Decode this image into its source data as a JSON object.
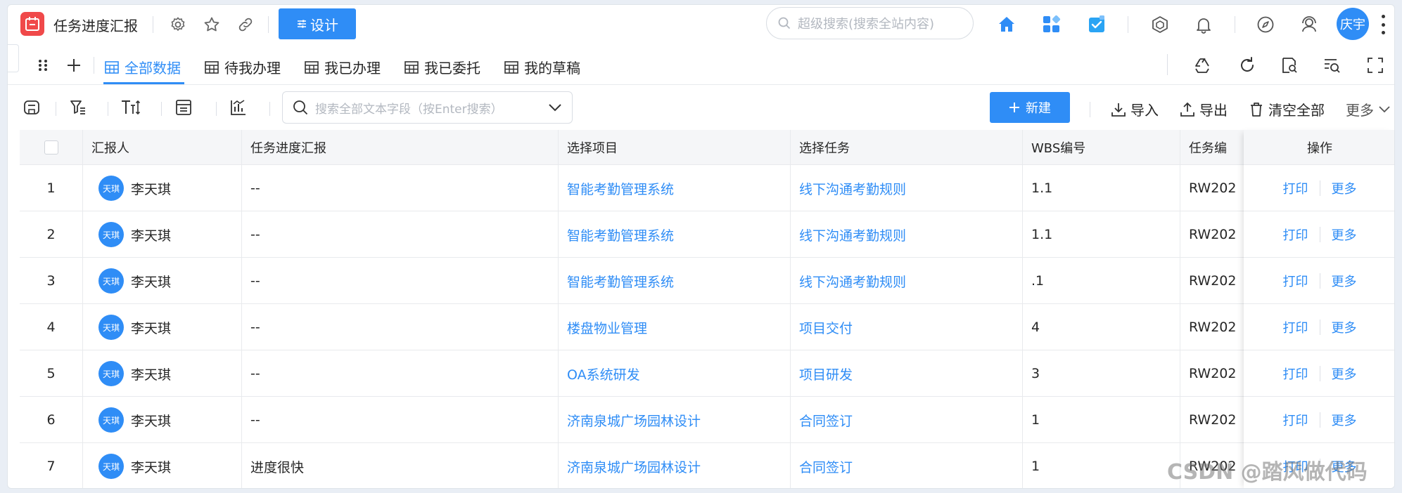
{
  "header": {
    "app_title": "任务进度汇报",
    "design_label": "设计",
    "search_placeholder": "超级搜索(搜索全站内容)",
    "user_name": "庆宇"
  },
  "tabs": [
    {
      "label": "全部数据",
      "active": true
    },
    {
      "label": "待我办理",
      "active": false
    },
    {
      "label": "我已办理",
      "active": false
    },
    {
      "label": "我已委托",
      "active": false
    },
    {
      "label": "我的草稿",
      "active": false
    }
  ],
  "toolbar": {
    "search_placeholder": "搜索全部文本字段（按Enter搜索）",
    "new_label": "新建",
    "import_label": "导入",
    "export_label": "导出",
    "clear_label": "清空全部",
    "more_label": "更多"
  },
  "table": {
    "columns": [
      "汇报人",
      "任务进度汇报",
      "选择项目",
      "选择任务",
      "WBS编号",
      "任务编",
      "操作"
    ],
    "rows": [
      {
        "no": "1",
        "avatar": "天琪",
        "reporter": "李天琪",
        "progress": "--",
        "project": "智能考勤管理系统",
        "task": "线下沟通考勤规则",
        "wbs": "1.1",
        "task_no": "RW202"
      },
      {
        "no": "2",
        "avatar": "天琪",
        "reporter": "李天琪",
        "progress": "--",
        "project": "智能考勤管理系统",
        "task": "线下沟通考勤规则",
        "wbs": "1.1",
        "task_no": "RW202"
      },
      {
        "no": "3",
        "avatar": "天琪",
        "reporter": "李天琪",
        "progress": "--",
        "project": "智能考勤管理系统",
        "task": "线下沟通考勤规则",
        "wbs": ".1",
        "task_no": "RW202"
      },
      {
        "no": "4",
        "avatar": "天琪",
        "reporter": "李天琪",
        "progress": "--",
        "project": "楼盘物业管理",
        "task": "项目交付",
        "wbs": "4",
        "task_no": "RW202"
      },
      {
        "no": "5",
        "avatar": "天琪",
        "reporter": "李天琪",
        "progress": "--",
        "project": "OA系统研发",
        "task": "项目研发",
        "wbs": "3",
        "task_no": "RW202"
      },
      {
        "no": "6",
        "avatar": "天琪",
        "reporter": "李天琪",
        "progress": "--",
        "project": "济南泉城广场园林设计",
        "task": "合同签订",
        "wbs": "1",
        "task_no": "RW202"
      },
      {
        "no": "7",
        "avatar": "天琪",
        "reporter": "李天琪",
        "progress": "进度很快",
        "project": "济南泉城广场园林设计",
        "task": "合同签订",
        "wbs": "1",
        "task_no": "RW202"
      }
    ],
    "op_print": "打印",
    "op_more": "更多"
  },
  "watermark": "CSDN @踏风做代码",
  "colors": {
    "accent": "#2f8df6",
    "app_icon": "#f0494a"
  }
}
